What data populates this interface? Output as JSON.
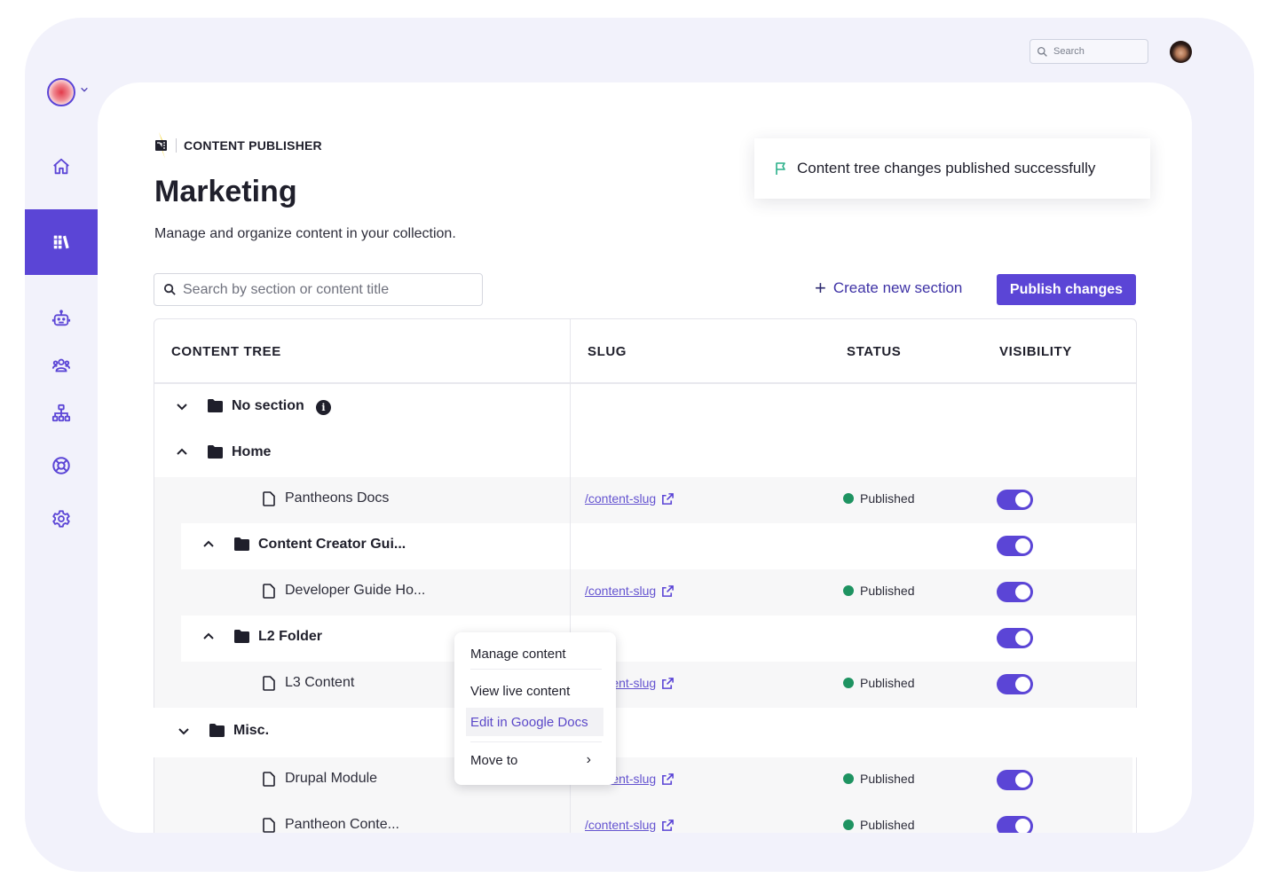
{
  "app": {
    "brand_menu": "brand-logo",
    "nav": [
      {
        "name": "home",
        "icon": "home-icon",
        "active": false
      },
      {
        "name": "library",
        "icon": "library-icon",
        "active": true
      },
      {
        "name": "ai-assistant",
        "icon": "robot-icon",
        "active": false
      },
      {
        "name": "users",
        "icon": "users-icon",
        "active": false
      },
      {
        "name": "sitemap",
        "icon": "sitemap-icon",
        "active": false
      },
      {
        "name": "help",
        "icon": "lifebuoy-icon",
        "active": false
      },
      {
        "name": "settings",
        "icon": "gear-icon",
        "active": false
      }
    ],
    "top_search": {
      "placeholder": "Search"
    }
  },
  "header": {
    "product_name": "CONTENT PUBLISHER",
    "title": "Marketing",
    "subtitle": "Manage and organize content in your collection."
  },
  "toast": {
    "icon": "flag-icon",
    "message": "Content tree changes published successfully"
  },
  "toolbar": {
    "search_placeholder": "Search by section or content title",
    "create_label": "Create new section",
    "publish_label": "Publish changes"
  },
  "table": {
    "columns": [
      "CONTENT TREE",
      "SLUG",
      "STATUS",
      "VISIBILITY"
    ],
    "rows": [
      {
        "type": "section",
        "name": "No section",
        "expanded": false,
        "info": true
      },
      {
        "type": "section",
        "name": "Home",
        "expanded": true
      },
      {
        "type": "content",
        "name": "Pantheons Docs",
        "slug": "/content-slug",
        "status": "Published",
        "visible": true
      },
      {
        "type": "section",
        "name": "Content Creator Gui...",
        "expanded": true,
        "visible": true
      },
      {
        "type": "content",
        "name": "Developer Guide Ho...",
        "slug": "/content-slug",
        "status": "Published",
        "visible": true
      },
      {
        "type": "section",
        "name": "L2 Folder",
        "expanded": true,
        "visible": true
      },
      {
        "type": "content",
        "name": "L3 Content",
        "slug": "/content-slug",
        "status": "Published",
        "visible": true
      },
      {
        "type": "section",
        "name": "Misc.",
        "expanded": false
      },
      {
        "type": "content",
        "name": "Drupal Module",
        "slug": "/content-slug",
        "status": "Published",
        "visible": true
      },
      {
        "type": "content",
        "name": "Pantheon Conte...",
        "slug": "/content-slug",
        "status": "Published",
        "visible": true
      }
    ]
  },
  "context_menu": {
    "items": [
      "Manage content",
      "View live content",
      "Edit in Google Docs",
      "Move to"
    ],
    "highlighted": "Edit in Google Docs"
  },
  "colors": {
    "accent": "#5b45d6",
    "published": "#1e9361",
    "toast_icon": "#2bb08a",
    "frame_bg": "#f2f2fb"
  }
}
